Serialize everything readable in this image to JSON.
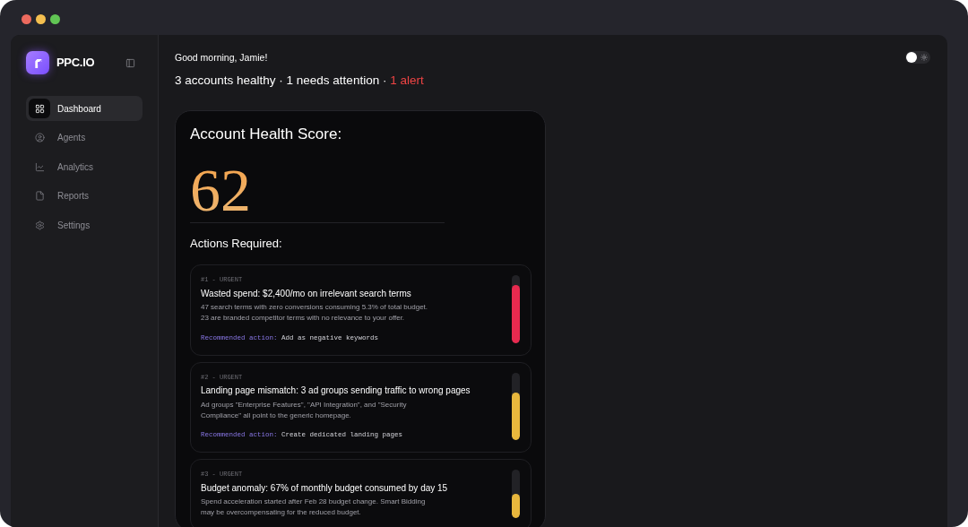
{
  "sidebar": {
    "brand": "PPC.IO",
    "items": [
      {
        "label": "Dashboard",
        "selected": true
      },
      {
        "label": "Agents",
        "selected": false
      },
      {
        "label": "Analytics",
        "selected": false
      },
      {
        "label": "Reports",
        "selected": false
      },
      {
        "label": "Settings",
        "selected": false
      }
    ]
  },
  "header": {
    "greeting": "Good morning, Jamie!",
    "summary": "3 accounts healthy · 1 needs attention ·",
    "alert": "1 alert"
  },
  "theme_toggle": {
    "on": false
  },
  "health_card": {
    "title": "Account Health Score:",
    "score": "62",
    "actions_title": "Actions Required:",
    "actions": [
      {
        "tag": "#1 - URGENT",
        "title": "Wasted spend: $2,400/mo on irrelevant search terms",
        "description": "47 search terms with zero conversions consuming 5.3% of total budget. 23 are branded competitor terms with no relevance to your offer.",
        "recommended_label": "Recommended action:",
        "recommended": "Add as negative keywords",
        "level": 0.86,
        "color": "#e72a4f"
      },
      {
        "tag": "#2 - URGENT",
        "title": "Landing page mismatch: 3 ad groups sending traffic to wrong pages",
        "description": "Ad groups \"Enterprise Features\", \"API Integration\", and \"Security Compliance\" all point to the generic homepage.",
        "recommended_label": "Recommended action:",
        "recommended": "Create dedicated landing pages",
        "level": 0.7,
        "color": "#e8b73d"
      },
      {
        "tag": "#3 - URGENT",
        "title": "Budget anomaly: 67% of monthly budget consumed by day 15",
        "description": "Spend acceleration started after Feb 28 budget change. Smart Bidding may be overcompensating for the reduced budget.",
        "level": 0.5,
        "color": "#e8b73d"
      }
    ]
  }
}
